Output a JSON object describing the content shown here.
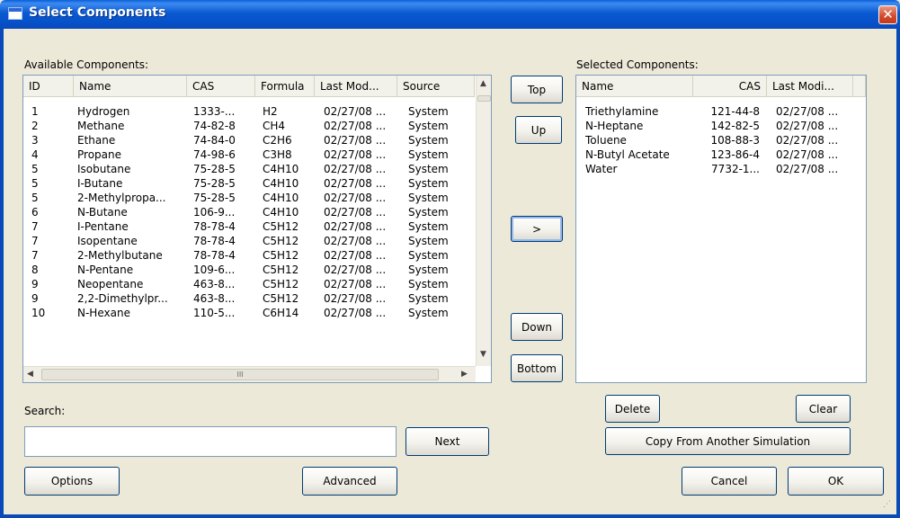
{
  "window": {
    "title": "Select Components",
    "close": "✕"
  },
  "available": {
    "label": "Available Components:",
    "columns": [
      "ID",
      "Name",
      "CAS",
      "Formula",
      "Last Mod...",
      "Source"
    ],
    "rows": [
      [
        "1",
        "Hydrogen",
        "1333-...",
        "H2",
        "02/27/08 ...",
        "System"
      ],
      [
        "2",
        "Methane",
        "74-82-8",
        "CH4",
        "02/27/08 ...",
        "System"
      ],
      [
        "3",
        "Ethane",
        "74-84-0",
        "C2H6",
        "02/27/08 ...",
        "System"
      ],
      [
        "4",
        "Propane",
        "74-98-6",
        "C3H8",
        "02/27/08 ...",
        "System"
      ],
      [
        "5",
        "Isobutane",
        "75-28-5",
        "C4H10",
        "02/27/08 ...",
        "System"
      ],
      [
        "5",
        "I-Butane",
        "75-28-5",
        "C4H10",
        "02/27/08 ...",
        "System"
      ],
      [
        "5",
        "2-Methylpropa...",
        "75-28-5",
        "C4H10",
        "02/27/08 ...",
        "System"
      ],
      [
        "6",
        "N-Butane",
        "106-9...",
        "C4H10",
        "02/27/08 ...",
        "System"
      ],
      [
        "7",
        "I-Pentane",
        "78-78-4",
        "C5H12",
        "02/27/08 ...",
        "System"
      ],
      [
        "7",
        "Isopentane",
        "78-78-4",
        "C5H12",
        "02/27/08 ...",
        "System"
      ],
      [
        "7",
        "2-Methylbutane",
        "78-78-4",
        "C5H12",
        "02/27/08 ...",
        "System"
      ],
      [
        "8",
        "N-Pentane",
        "109-6...",
        "C5H12",
        "02/27/08 ...",
        "System"
      ],
      [
        "9",
        "Neopentane",
        "463-8...",
        "C5H12",
        "02/27/08 ...",
        "System"
      ],
      [
        "9",
        "2,2-Dimethylpr...",
        "463-8...",
        "C5H12",
        "02/27/08 ...",
        "System"
      ],
      [
        "10",
        "N-Hexane",
        "110-5...",
        "C6H14",
        "02/27/08 ...",
        "System"
      ]
    ],
    "hscroll_thumb_glyph": "III"
  },
  "selected": {
    "label": "Selected Components:",
    "columns": [
      "Name",
      "CAS",
      "Last Modi..."
    ],
    "rows": [
      [
        "Triethylamine",
        "121-44-8",
        "02/27/08 ..."
      ],
      [
        "N-Heptane",
        "142-82-5",
        "02/27/08 ..."
      ],
      [
        "Toluene",
        "108-88-3",
        "02/27/08 ..."
      ],
      [
        "N-Butyl Acetate",
        "123-86-4",
        "02/27/08 ..."
      ],
      [
        "Water",
        "7732-1...",
        "02/27/08 ..."
      ]
    ]
  },
  "move": {
    "top": "Top",
    "up": "Up",
    "add": ">",
    "down": "Down",
    "bottom": "Bottom"
  },
  "search": {
    "label": "Search:",
    "value": "",
    "next": "Next"
  },
  "buttons": {
    "options": "Options",
    "advanced": "Advanced",
    "delete": "Delete",
    "clear": "Clear",
    "copy": "Copy From Another Simulation",
    "cancel": "Cancel",
    "ok": "OK"
  }
}
